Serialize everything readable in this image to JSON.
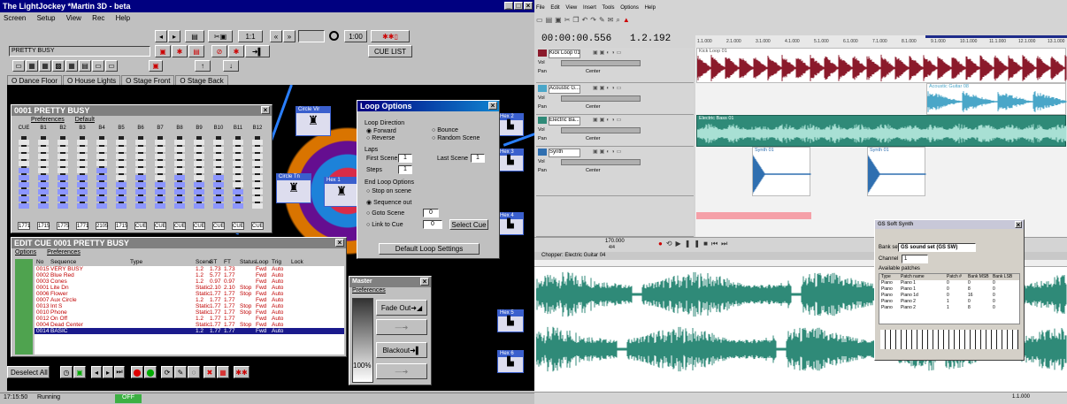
{
  "left": {
    "window_title": "The LightJockey *Martin 3D - beta",
    "menu": [
      "Screen",
      "Setup",
      "View",
      "Rec",
      "Help"
    ],
    "cue_name": "PRETTY BUSY",
    "cue_list_button": "CUE LIST",
    "toolbar_counter": "1:1",
    "toolbar_value": "1:00",
    "tabs": [
      "O Dance Floor",
      "O House Lights",
      "O Stage Front",
      "O Stage Back"
    ],
    "preset_window": {
      "title": "0001 PRETTY BUSY",
      "menu": [
        "Preferences",
        "Default"
      ],
      "columns": [
        "CUE",
        "B1",
        "B2",
        "B3",
        "B4",
        "B5",
        "B6",
        "B7",
        "B8",
        "B9",
        "B10",
        "B11",
        "B12"
      ],
      "bottom_values": [
        "1771",
        "1715",
        "1775",
        "1771",
        "2105",
        "1715",
        "CUE",
        "CUE",
        "CUE",
        "CUE",
        "CUE",
        "CUE",
        "CUE"
      ],
      "levels": [
        0.7,
        0.5,
        0.5,
        0.55,
        0.6,
        0.4,
        0.5,
        0.45,
        0.5,
        0.4,
        0.5,
        0.3,
        0.0
      ]
    },
    "loop_dialog": {
      "title": "Loop Options",
      "direction_label": "Loop Direction",
      "forward": "Forward",
      "reverse": "Reverse",
      "bounce": "Bounce",
      "random": "Random Scene",
      "laps_label": "Laps",
      "first_scene": "First Scene",
      "first_scene_val": "1",
      "last_scene": "Last Scene",
      "last_scene_val": "1",
      "steps": "Steps",
      "steps_val": "1",
      "end_label": "End Loop Options",
      "stop": "Stop on scene",
      "sequence": "Sequence out",
      "goto": "Goto Scene",
      "goto_val": "0",
      "link": "Link to Cue",
      "link_val": "0",
      "select_cue": "Select Cue",
      "default_button": "Default Loop Settings"
    },
    "edit_cue": {
      "title": "EDIT CUE 0001 PRETTY BUSY",
      "menu": [
        "Options",
        "Preferences"
      ],
      "columns": [
        "No",
        "Sequence",
        "Type",
        "Scene",
        "ST",
        "FT",
        "Status",
        "Loop",
        "Trig",
        "Lock"
      ],
      "rows": [
        [
          "0015",
          "VERY BUSY",
          "",
          "1.2",
          "1.73",
          "1.73",
          "",
          "Fwd",
          "Auto",
          ""
        ],
        [
          "0002",
          "Blue Red",
          "",
          "1.2",
          "5.77",
          "1.77",
          "",
          "Fwd",
          "Auto",
          ""
        ],
        [
          "0003",
          "Cones",
          "",
          "1.2",
          "0.97",
          "0.97",
          "",
          "Fwd",
          "Auto",
          ""
        ],
        [
          "0001",
          "Lite Dn",
          "",
          "Static",
          "2.10",
          "2.10",
          "Stop",
          "Fwd",
          "Auto",
          ""
        ],
        [
          "0006",
          "Flower",
          "",
          "Static",
          "1.77",
          "1.77",
          "Stop",
          "Fwd",
          "Auto",
          ""
        ],
        [
          "0007",
          "Aux Circle",
          "",
          "1.2",
          "1.77",
          "1.77",
          "",
          "Fwd",
          "Auto",
          ""
        ],
        [
          "0013",
          "Int S",
          "",
          "Static",
          "1.77",
          "1.77",
          "Stop",
          "Fwd",
          "Auto",
          ""
        ],
        [
          "0010",
          "Phone",
          "",
          "Static",
          "1.77",
          "1.77",
          "Stop",
          "Fwd",
          "Auto",
          ""
        ],
        [
          "0012",
          "On Off",
          "",
          "1.2",
          "1.77",
          "1.77",
          "",
          "Fwd",
          "Auto",
          ""
        ],
        [
          "0004",
          "Dead Center",
          "",
          "Static",
          "1.77",
          "1.77",
          "Stop",
          "Fwd",
          "Auto",
          ""
        ],
        [
          "0014",
          "BASIC",
          "",
          "1.2",
          "1.77",
          "1.77",
          "",
          "Fwd",
          "Auto",
          ""
        ]
      ]
    },
    "master": {
      "title": "Master",
      "menu": "Preferences",
      "percent": "100%",
      "fade_out": "Fade Out",
      "blackout": "Blackout"
    },
    "bottom_toolbar_select": "Deselect All",
    "status_time": "17:15:50",
    "status_state": "Running",
    "status_green": "OFF",
    "cue_tiles": [
      "Circle Vir",
      "Circle Tn",
      "Hex 1",
      "Hex 2",
      "Hex 3",
      "Hex 4",
      "Hex 5",
      "Hex 6"
    ]
  },
  "right": {
    "menu": [
      "File",
      "Edit",
      "View",
      "Insert",
      "Tools",
      "Options",
      "Help"
    ],
    "time_display": "00:00:00.556",
    "beat_display": "1.2.192",
    "ruler_labels": [
      "1.1.000",
      "2.1.000",
      "3.1.000",
      "4.1.000",
      "5.1.000",
      "6.1.000",
      "7.1.000",
      "8.1.000",
      "9.1.000",
      "10.1.000",
      "11.1.000",
      "12.1.000",
      "13.1.000"
    ],
    "tracks": [
      {
        "name": "Kick Loop 01",
        "clip": "Kick Loop 01",
        "color": "#8b1a2b"
      },
      {
        "name": "Acoustic G...",
        "clip": "Acoustic Guitar 08",
        "color": "#4aa6c8"
      },
      {
        "name": "Electric Ba...",
        "clip": "Electric Bass 01",
        "color": "#2f8a78"
      },
      {
        "name": "Synth",
        "clip": "Synth 01",
        "color": "#2f6fb0"
      }
    ],
    "track_labels": [
      "Vol",
      "Pan",
      "Center",
      "Mute",
      "Solo"
    ],
    "chopper_title": "Chopper: Electric Guitar 04",
    "tempo": "170.000",
    "measure": "4/4",
    "midi_dialog": {
      "title": "GS Soft Synth",
      "bank_label": "Bank set",
      "bank_value": "GS sound set (GS SW)",
      "channel_label": "Channel",
      "channel_value": "1",
      "patches_label": "Available patches",
      "columns": [
        "Type",
        "Patch name",
        "Patch #",
        "Bank MSB",
        "Bank LSB"
      ],
      "rows": [
        [
          "Piano",
          "Piano 1",
          "0",
          "0",
          "0"
        ],
        [
          "Piano",
          "Piano 1",
          "0",
          "8",
          "0"
        ],
        [
          "Piano",
          "Piano 1d",
          "0",
          "16",
          "0"
        ],
        [
          "Piano",
          "Piano 2",
          "1",
          "0",
          "0"
        ],
        [
          "Piano",
          "Piano 2",
          "1",
          "8",
          "0"
        ]
      ]
    },
    "bottom_status": "1.1.000"
  }
}
